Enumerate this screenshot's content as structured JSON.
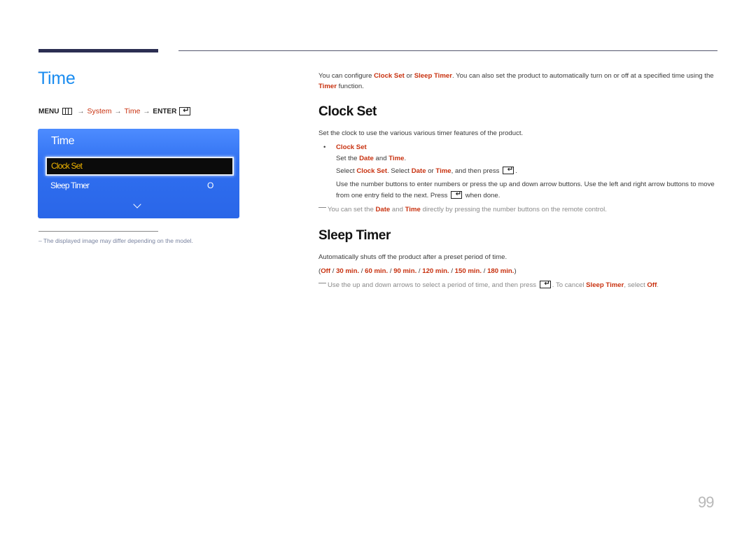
{
  "page": {
    "title": "Time",
    "page_number": "99",
    "accent_color": "#1a8cf0",
    "highlight_color": "#c8310f"
  },
  "menu_path": {
    "menu": "MENU",
    "system": "System",
    "time": "Time",
    "enter": "ENTER",
    "arrow": "→"
  },
  "osd": {
    "title": "Time",
    "items": [
      {
        "label": "Clock Set",
        "value": "",
        "selected": true
      },
      {
        "label": "Sleep Timer",
        "value": "O",
        "selected": false
      }
    ]
  },
  "left_note": "–  The displayed image may differ depending on the model.",
  "intro": {
    "t1": "You can configure ",
    "k1": "Clock Set",
    "t2": " or ",
    "k2": "Sleep Timer",
    "t3": ". You can also set the product to automatically turn on or off at a specified time using the ",
    "k3": "Timer",
    "t4": " function."
  },
  "clock_set": {
    "heading": "Clock Set",
    "desc": "Set the clock to use the various various timer features of the product.",
    "bullet": "Clock Set",
    "line1": {
      "t1": "Set the ",
      "k1": "Date",
      "t2": " and ",
      "k2": "Time",
      "t3": "."
    },
    "line2": {
      "t1": "Select ",
      "k1": "Clock Set",
      "t2": ". Select ",
      "k2": "Date",
      "t3": " or ",
      "k3": "Time",
      "t4": ", and then press ",
      "t5": "."
    },
    "line3": {
      "t1": "Use the number buttons to enter numbers or press the up and down arrow buttons. Use the left and right arrow buttons to move from one entry field to the next. Press ",
      "t2": " when done."
    },
    "note": {
      "t1": "You can set the ",
      "k1": "Date",
      "t2": " and ",
      "k2": "Time",
      "t3": " directly by pressing the number buttons on the remote control."
    }
  },
  "sleep_timer": {
    "heading": "Sleep Timer",
    "desc": "Automatically shuts off the product after a preset period of time.",
    "options": [
      "Off",
      "30 min.",
      "60 min.",
      "90 min.",
      "120 min.",
      "150 min.",
      "180 min."
    ],
    "note": {
      "t1": "Use the up and down arrows to select a period of time, and then press ",
      "t2": ". To cancel ",
      "k1": "Sleep Timer",
      "t3": ", select ",
      "k2": "Off",
      "t4": "."
    }
  }
}
